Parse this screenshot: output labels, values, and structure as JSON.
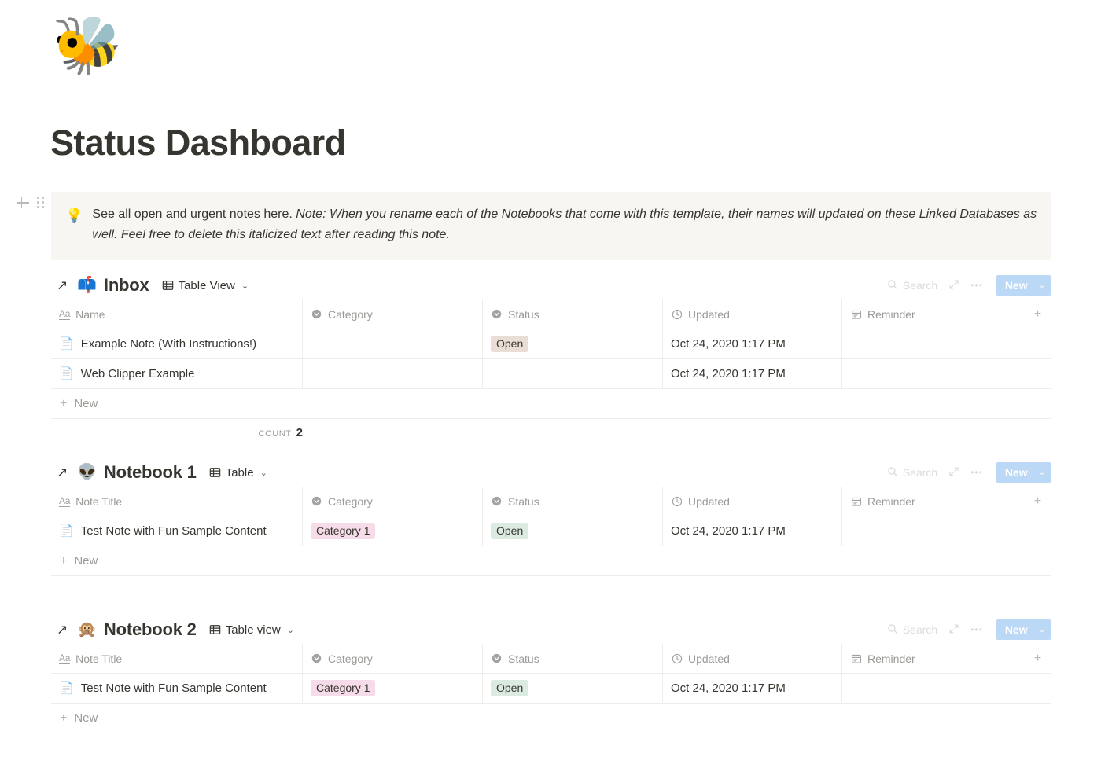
{
  "page": {
    "icon": "🐝",
    "icon_name": "bee-emoji",
    "title": "Status Dashboard"
  },
  "block_controls": {
    "add_block_label": "+",
    "drag_handle_label": "⠿"
  },
  "callout": {
    "emoji": "💡",
    "text_plain": "See all open and urgent notes here. ",
    "text_italic": "Note: When you rename each of the Notebooks that come with this template, their names will updated on these Linked Databases as well. Feel free to delete this italicized text after reading this note.",
    "background": "#f7f6f3"
  },
  "toolbar": {
    "search_label": "Search",
    "expand_label": "⤢",
    "more_label": "•••",
    "new_label": "New",
    "new_chevron": "⌄",
    "new_color": "#2383e2"
  },
  "colors": {
    "tag_open_inbox": "#eaddd5",
    "tag_open_green": "#dcebe1",
    "tag_category_pink": "#f5dce8",
    "border": "#eeedeb",
    "text": "#37352f",
    "muted": "#9b9a97"
  },
  "databases": [
    {
      "link_arrow": "↗",
      "emoji": "📫",
      "emoji_name": "mailbox-emoji",
      "title": "Inbox",
      "view_label": "Table View",
      "view_chevron": "⌄",
      "columns": [
        {
          "label": "Name",
          "icon": "Aa",
          "icon_name": "title-text-icon"
        },
        {
          "label": "Category",
          "icon": "select",
          "icon_name": "select-icon"
        },
        {
          "label": "Status",
          "icon": "select",
          "icon_name": "select-icon"
        },
        {
          "label": "Updated",
          "icon": "clock",
          "icon_name": "clock-icon"
        },
        {
          "label": "Reminder",
          "icon": "calendar",
          "icon_name": "calendar-icon"
        }
      ],
      "add_column_label": "+",
      "rows": [
        {
          "page_icon": "📄",
          "name": "Example Note (With Instructions!)",
          "category": "",
          "category_color": "",
          "status": "Open",
          "status_color": "#eaddd5",
          "updated": "Oct 24, 2020 1:17 PM",
          "reminder": ""
        },
        {
          "page_icon": "📄",
          "name": "Web Clipper Example",
          "category": "",
          "category_color": "",
          "status": "",
          "status_color": "",
          "updated": "Oct 24, 2020 1:17 PM",
          "reminder": ""
        }
      ],
      "new_row_label": "New",
      "new_row_plus": "+",
      "count_label": "Count",
      "count_value": "2",
      "has_count": true
    },
    {
      "link_arrow": "↗",
      "emoji": "👽",
      "emoji_name": "alien-emoji",
      "title": "Notebook 1",
      "view_label": "Table",
      "view_chevron": "⌄",
      "columns": [
        {
          "label": "Note Title",
          "icon": "Aa",
          "icon_name": "title-text-icon"
        },
        {
          "label": "Category",
          "icon": "select",
          "icon_name": "select-icon"
        },
        {
          "label": "Status",
          "icon": "select",
          "icon_name": "select-icon"
        },
        {
          "label": "Updated",
          "icon": "clock",
          "icon_name": "clock-icon"
        },
        {
          "label": "Reminder",
          "icon": "calendar",
          "icon_name": "calendar-icon"
        }
      ],
      "add_column_label": "+",
      "rows": [
        {
          "page_icon": "📄",
          "name": "Test Note with Fun Sample Content",
          "category": "Category 1",
          "category_color": "#f5dce8",
          "status": "Open",
          "status_color": "#dcebe1",
          "updated": "Oct 24, 2020 1:17 PM",
          "reminder": ""
        }
      ],
      "new_row_label": "New",
      "new_row_plus": "+",
      "count_label": "",
      "count_value": "",
      "has_count": false
    },
    {
      "link_arrow": "↗",
      "emoji": "🙊",
      "emoji_name": "monkey-emoji",
      "title": "Notebook 2",
      "view_label": "Table view",
      "view_chevron": "⌄",
      "columns": [
        {
          "label": "Note Title",
          "icon": "Aa",
          "icon_name": "title-text-icon"
        },
        {
          "label": "Category",
          "icon": "select",
          "icon_name": "select-icon"
        },
        {
          "label": "Status",
          "icon": "select",
          "icon_name": "select-icon"
        },
        {
          "label": "Updated",
          "icon": "clock",
          "icon_name": "clock-icon"
        },
        {
          "label": "Reminder",
          "icon": "calendar",
          "icon_name": "calendar-icon"
        }
      ],
      "add_column_label": "+",
      "rows": [
        {
          "page_icon": "📄",
          "name": "Test Note with Fun Sample Content",
          "category": "Category 1",
          "category_color": "#f5dce8",
          "status": "Open",
          "status_color": "#dcebe1",
          "updated": "Oct 24, 2020 1:17 PM",
          "reminder": ""
        }
      ],
      "new_row_label": "New",
      "new_row_plus": "+",
      "count_label": "",
      "count_value": "",
      "has_count": false
    }
  ]
}
